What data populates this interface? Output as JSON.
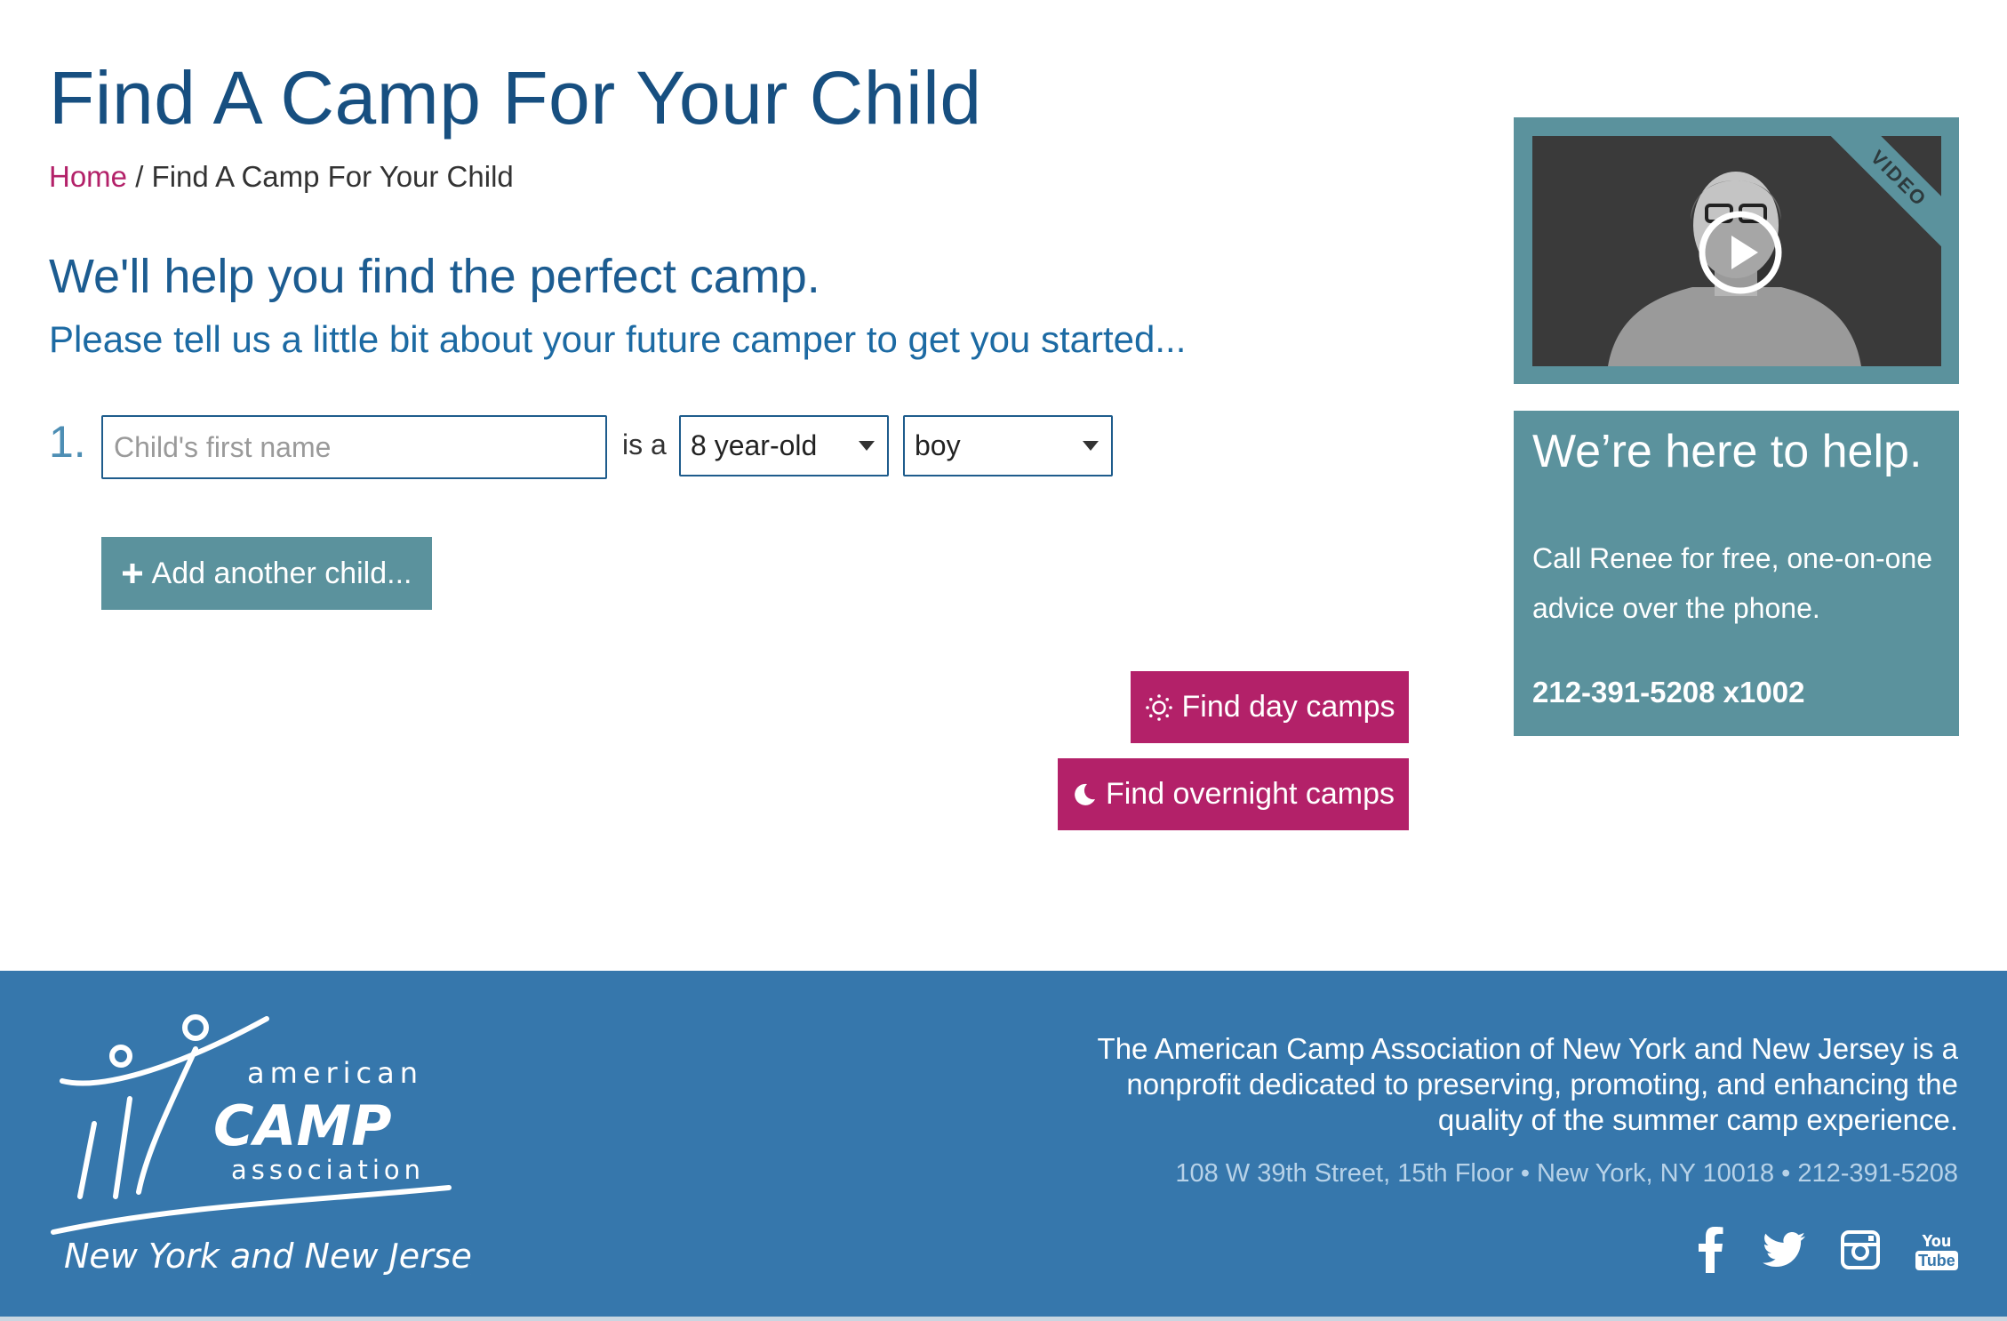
{
  "header": {
    "title": "Find A Camp For Your Child",
    "breadcrumb": {
      "home": "Home",
      "separator": " / ",
      "current": "Find A Camp For Your Child"
    }
  },
  "intro": {
    "heading": "We'll help you find the perfect camp.",
    "subheading": "Please tell us a little bit about your future camper to get you started..."
  },
  "form": {
    "row_number": "1.",
    "name_placeholder": "Child's first name",
    "name_value": "",
    "connector": "is a",
    "age_selected": "8 year-old",
    "gender_selected": "boy",
    "add_child_label": "Add another child...",
    "day_camps_label": "Find day camps",
    "overnight_camps_label": "Find overnight camps"
  },
  "video": {
    "badge": "VIDEO"
  },
  "help": {
    "title": "We’re here to help.",
    "text": "Call Renee for free, one-on-one advice over the phone.",
    "phone": "212-391-5208 x1002"
  },
  "footer": {
    "logo_text": {
      "line1": "american",
      "line2": "CAMP",
      "line3": "association",
      "region": "New York and New Jersey"
    },
    "description": "The American Camp Association of New York and New Jersey is a nonprofit dedicated to preserving, promoting, and enhancing the quality of the summer camp experience.",
    "address": "108 W 39th Street, 15th Floor • New York, NY 10018 • 212-391-5208",
    "social": [
      "facebook-icon",
      "twitter-icon",
      "instagram-icon",
      "youtube-icon"
    ],
    "youtube_you": "You",
    "youtube_tube": "Tube"
  },
  "colors": {
    "title_blue": "#174f80",
    "accent_magenta": "#b32169",
    "teal": "#5b929d",
    "footer_blue": "#3677ac"
  }
}
